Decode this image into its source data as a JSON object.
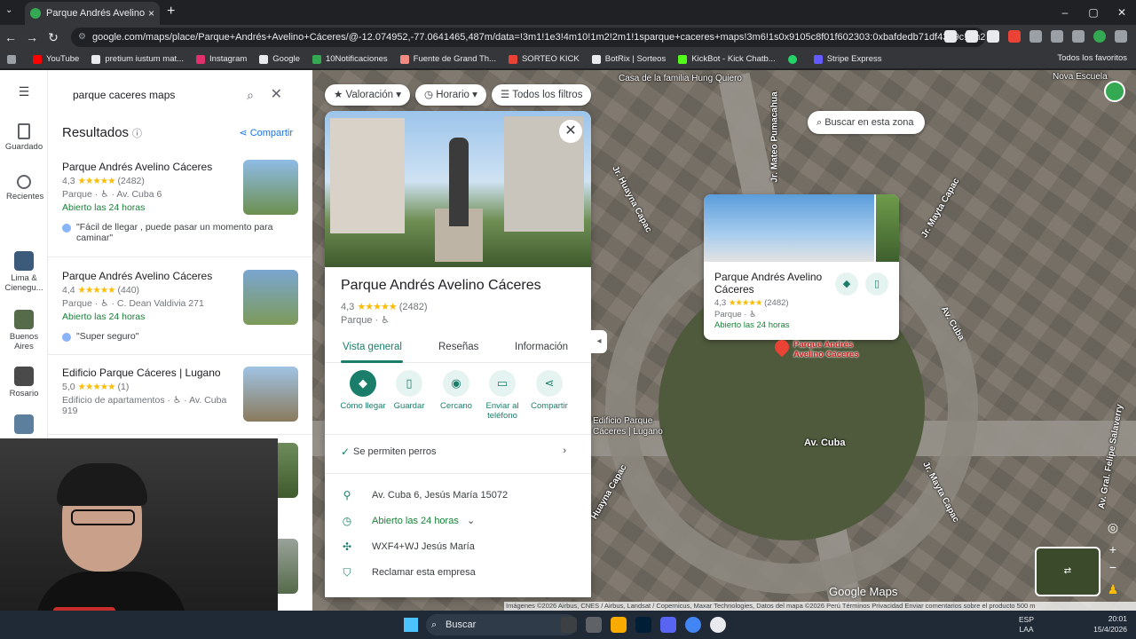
{
  "browser": {
    "tab_title": "Parque Andrés Avelino Cáceres",
    "url": "google.com/maps/place/Parque+Andrés+Avelino+Cáceres/@-12.074952,-77.0641465,487m/data=!3m1!1e3!4m10!1m2!2m1!1sparque+caceres+maps!3m6!1s0x9105c8f01f602303:0xbafdedb71df4319c!8m2!3d-12.0752192!4d...",
    "bookmarks": [
      "YouTube",
      "pretium iustum mat...",
      "Instagram",
      "Google",
      "10Notificaciones",
      "Fuente de Grand Th...",
      "SORTEO KICK",
      "BotRix | Sorteos",
      "KickBot - Kick Chatb...",
      "Stripe Express"
    ],
    "bookmarks_right": "Todos los favoritos"
  },
  "rail": {
    "items": [
      {
        "label": "Guardado",
        "icon": "bookmark-icon"
      },
      {
        "label": "Recientes",
        "icon": "history-icon"
      },
      {
        "label": "Lima & Cienegu...",
        "icon": "thumbnail-icon"
      },
      {
        "label": "Buenos Aires",
        "icon": "thumbnail-icon"
      },
      {
        "label": "Rosario",
        "icon": "thumbnail-icon"
      }
    ]
  },
  "search": {
    "query": "parque caceres maps",
    "results_title": "Resultados",
    "share_label": "Compartir",
    "results": [
      {
        "name": "Parque Andrés Avelino Cáceres",
        "rating": "4,3",
        "stars": "★★★★★",
        "reviews": "(2482)",
        "meta": "Parque · ♿ · Av. Cuba 6",
        "hours": "Abierto las 24 horas",
        "quote": "\"Fácil de llegar , puede pasar un momento para caminar\""
      },
      {
        "name": "Parque Andrés Avelino Cáceres",
        "rating": "4,4",
        "stars": "★★★★★",
        "reviews": "(440)",
        "meta": "Parque · ♿ · C. Dean Valdivia 271",
        "hours": "Abierto las 24 horas",
        "quote": "\"Super seguro\""
      },
      {
        "name": "Edificio Parque Cáceres | Lugano",
        "rating": "5,0",
        "stars": "★★★★★",
        "reviews": "(1)",
        "meta": "Edificio de apartamentos · ♿ · Av. Cuba 919",
        "hours": "",
        "quote": ""
      }
    ]
  },
  "filters": [
    "Valoración",
    "Horario",
    "Todos los filtros"
  ],
  "detail": {
    "title": "Parque Andrés Avelino Cáceres",
    "rating": "4,3",
    "stars": "★★★★★",
    "reviews": "(2482)",
    "type": "Parque · ♿",
    "tabs": [
      "Vista general",
      "Reseñas",
      "Información"
    ],
    "actions": [
      "Cómo llegar",
      "Guardar",
      "Cercano",
      "Enviar al teléfono",
      "Compartir"
    ],
    "pets": "Se permiten perros",
    "address": "Av. Cuba 6, Jesús María 15072",
    "hours": "Abierto las 24 horas",
    "plus_code": "WXF4+WJ Jesús María",
    "claim": "Reclamar esta empresa"
  },
  "map": {
    "search_area": "Buscar en esta zona",
    "popup": {
      "name": "Parque Andrés Avelino Cáceres",
      "rating": "4,3",
      "stars": "★★★★★",
      "reviews": "(2482)",
      "type": "Parque · ♿",
      "hours": "Abierto las 24 horas"
    },
    "pin_label": "Parque Andrés Avelino Cáceres",
    "labels": {
      "casa": "Casa de la familia Hung Quiero",
      "nova": "Nova Escuela",
      "huayna1": "Jr. Huayna Capac",
      "mateo": "Jr. Mateo Pumacahua",
      "mayta1": "Jr. Mayta Capac",
      "cuba1": "Av. Cuba",
      "edificio": "Edificio Parque Cáceres | Lugano",
      "cuba2": "Av. Cuba",
      "huayna2": "Huayna Capac",
      "mayta2": "Jr. Mayta Capac",
      "salaverry": "Av. Gral. Felipe Salaverry"
    },
    "brand": "Google Maps",
    "attribution": "Imágenes ©2026 Airbus, CNES / Airbus, Landsat / Copernicus, Maxar Technologies, Datos del mapa ©2026   Perú   Términos   Privacidad   Enviar comentarios sobre el producto   500 m"
  },
  "taskbar": {
    "search": "Buscar",
    "lang_top": "ESP",
    "lang_bottom": "LAA",
    "time": "20:01",
    "date": "15/4/2026"
  }
}
